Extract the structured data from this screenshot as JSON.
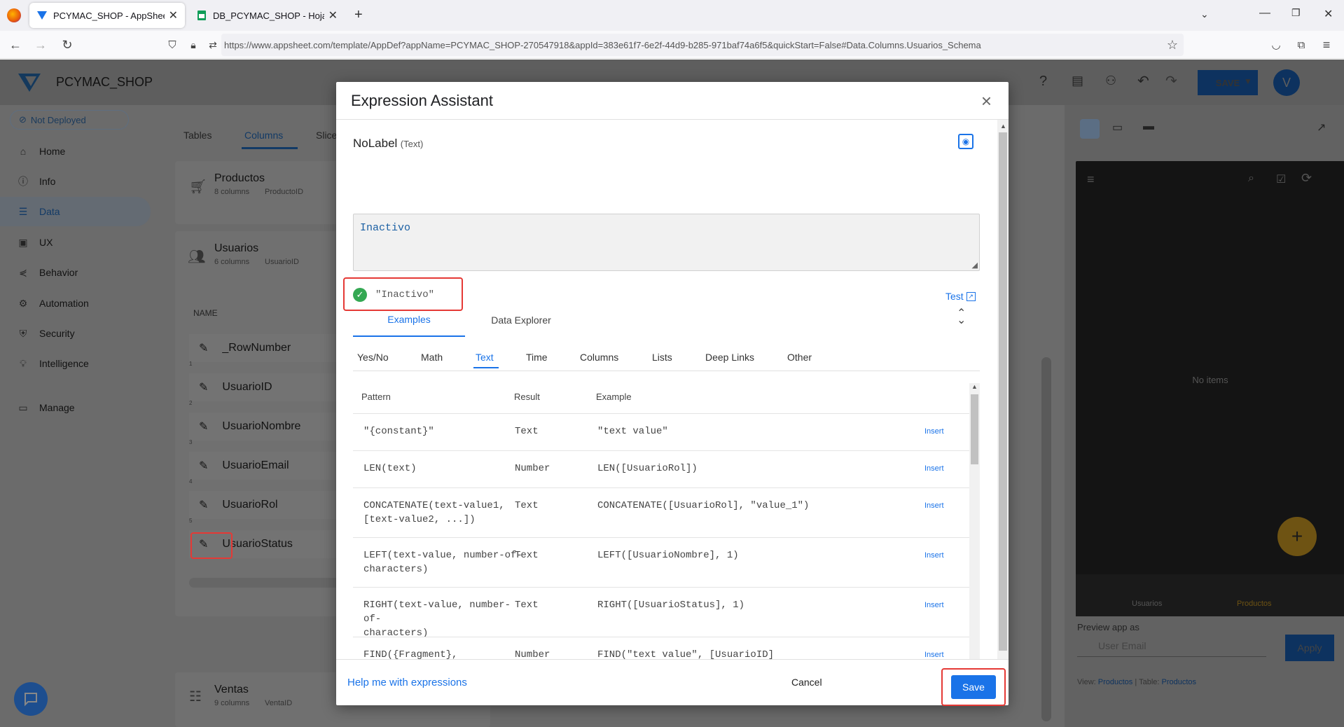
{
  "browser": {
    "tabs": [
      {
        "title": "PCYMAC_SHOP - AppSheet",
        "active": true
      },
      {
        "title": "DB_PCYMAC_SHOP - Hojas de",
        "active": false
      }
    ],
    "url": "https://www.appsheet.com/template/AppDef?appName=PCYMAC_SHOP-270547918&appId=383e61f7-6e2f-44d9-b285-971baf74a6f5&quickStart=False#Data.Columns.Usuarios_Schema"
  },
  "app": {
    "name": "PCYMAC_SHOP",
    "save_label": "SAVE",
    "avatar": "V",
    "deploy_status": "Not Deployed",
    "nav": [
      "Home",
      "Info",
      "Data",
      "UX",
      "Behavior",
      "Automation",
      "Security",
      "Intelligence",
      "Manage"
    ],
    "content_tabs": [
      "Tables",
      "Columns",
      "Slice"
    ],
    "tables": [
      {
        "name": "Productos",
        "meta": "8 columns",
        "key": "ProductoID"
      },
      {
        "name": "Usuarios",
        "meta": "6 columns",
        "key": "UsuarioID"
      },
      {
        "name": "Ventas",
        "meta": "9 columns",
        "key": "VentaID"
      }
    ],
    "name_header": "NAME",
    "row_numbers": [
      "1",
      "2",
      "3",
      "4",
      "5"
    ],
    "columns": [
      "_RowNumber",
      "UsuarioID",
      "UsuarioNombre",
      "UsuarioEmail",
      "UsuarioRol",
      "UsuarioStatus"
    ],
    "preview": {
      "no_items": "No items",
      "bottom_tabs": [
        "Usuarios",
        "Productos"
      ],
      "preview_as": "Preview app as",
      "email_placeholder": "User Email",
      "apply": "Apply",
      "view_label": "View:",
      "view_value": "Productos",
      "table_label": "Table:",
      "table_value": "Productos"
    }
  },
  "modal": {
    "title": "Expression Assistant",
    "field_name": "NoLabel",
    "field_type": "(Text)",
    "expression": "Inactivo",
    "result": "\"Inactivo\"",
    "test_label": "Test",
    "main_tabs": [
      "Examples",
      "Data Explorer"
    ],
    "categories": [
      "Yes/No",
      "Math",
      "Text",
      "Time",
      "Columns",
      "Lists",
      "Deep Links",
      "Other"
    ],
    "active_category": "Text",
    "headers": {
      "pattern": "Pattern",
      "result": "Result",
      "example": "Example"
    },
    "rows": [
      {
        "pattern": "\"{constant}\"",
        "result": "Text",
        "example": "\"text value\"",
        "action": "Insert"
      },
      {
        "pattern": "LEN(text)",
        "result": "Number",
        "example": "LEN([UsuarioRol])",
        "action": "Insert"
      },
      {
        "pattern": "CONCATENATE(text-value1,\n[text-value2, ...])",
        "result": "Text",
        "example": "CONCATENATE([UsuarioRol], \"value_1\")",
        "action": "Insert"
      },
      {
        "pattern": "LEFT(text-value, number-of-\ncharacters)",
        "result": "Text",
        "example": "LEFT([UsuarioNombre], 1)",
        "action": "Insert"
      },
      {
        "pattern": "RIGHT(text-value, number-of-\ncharacters)",
        "result": "Text",
        "example": "RIGHT([UsuarioStatus], 1)",
        "action": "Insert"
      },
      {
        "pattern": "FIND({Fragment},\n{TextValue})",
        "result": "Number",
        "example": "FIND(\"text value\", [UsuarioID]",
        "action": "Insert"
      }
    ],
    "help_link": "Help me with expressions",
    "cancel_label": "Cancel",
    "save_label": "Save"
  },
  "colors": {
    "accent": "#1a73e8",
    "highlight": "#e53935",
    "success": "#34a853"
  }
}
